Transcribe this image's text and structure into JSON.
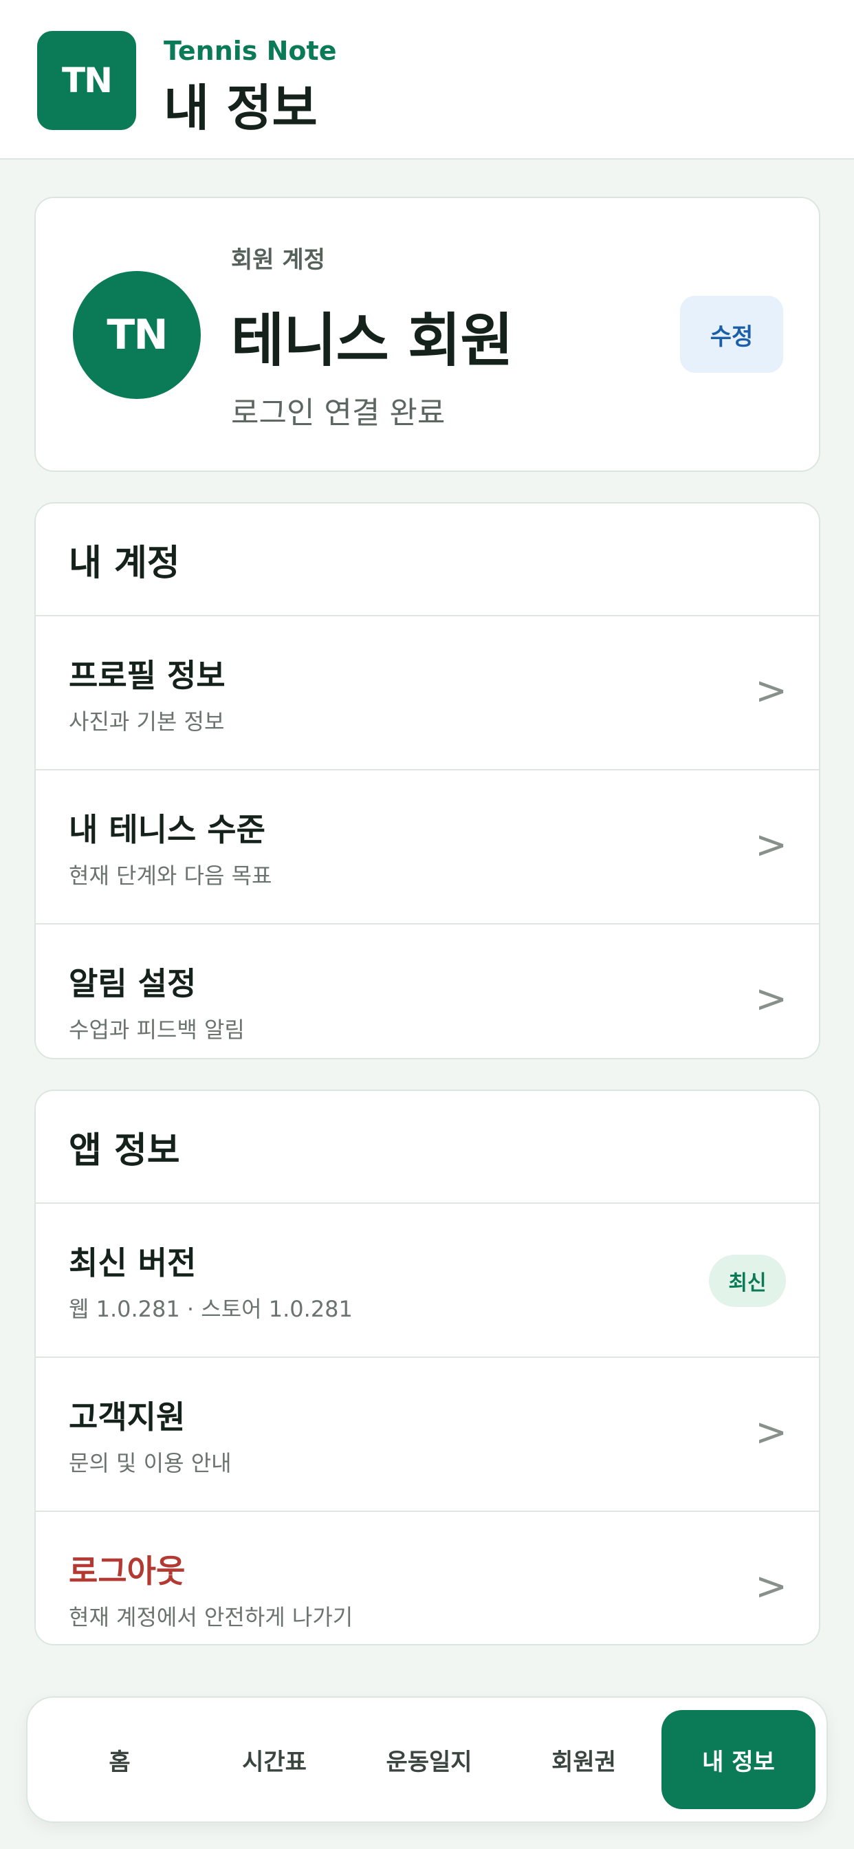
{
  "header": {
    "logo_text": "TN",
    "brand": "Tennis Note",
    "title": "내 정보"
  },
  "profile": {
    "avatar_text": "TN",
    "account_label": "회원 계정",
    "name": "테니스 회원",
    "status": "로그인 연결 완료",
    "edit_label": "수정"
  },
  "account_section": {
    "title": "내 계정",
    "items": [
      {
        "title": "프로필 정보",
        "subtitle": "사진과 기본 정보",
        "chevron": ">"
      },
      {
        "title": "내 테니스 수준",
        "subtitle": "현재 단계와 다음 목표",
        "chevron": ">"
      },
      {
        "title": "알림 설정",
        "subtitle": "수업과 피드백 알림",
        "chevron": ">"
      }
    ]
  },
  "app_section": {
    "title": "앱 정보",
    "version": {
      "title": "최신 버전",
      "subtitle": "웹 1.0.281 · 스토어 1.0.281",
      "badge": "최신"
    },
    "support": {
      "title": "고객지원",
      "subtitle": "문의 및 이용 안내",
      "chevron": ">"
    },
    "logout": {
      "title": "로그아웃",
      "subtitle": "현재 계정에서 안전하게 나가기",
      "chevron": ">"
    }
  },
  "tabbar": {
    "tabs": [
      "홈",
      "시간표",
      "운동일지",
      "회원권",
      "내 정보"
    ],
    "active": "내 정보"
  },
  "colors": {
    "brand": "#0b7a56",
    "danger": "#b23a32",
    "edit_button_bg": "#e7f1fb",
    "background": "#f2f6f3"
  }
}
